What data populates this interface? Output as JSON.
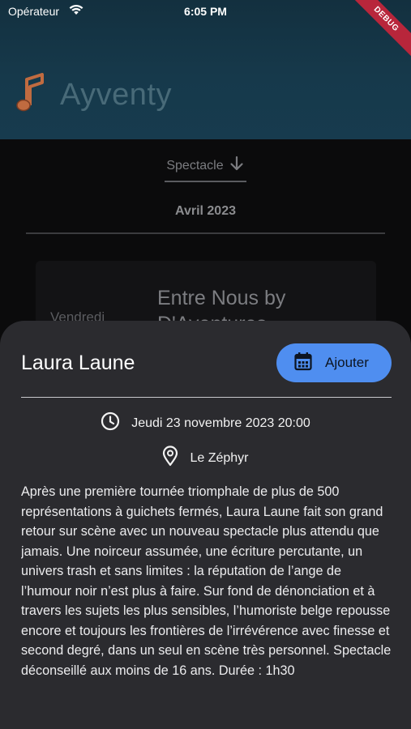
{
  "status_bar": {
    "carrier": "Opérateur",
    "time": "6:05 PM",
    "debug_label": "DEBUG"
  },
  "app": {
    "title": "Ayventy",
    "logo_icon": "music-note-icon"
  },
  "filter": {
    "label": "Spectacle",
    "icon": "arrow-down-icon"
  },
  "month": "Avril 2023",
  "event_card": {
    "day": "Vendredi",
    "title": "Entre Nous by D'Aventures"
  },
  "sheet": {
    "title": "Laura Laune",
    "add_button": "Ajouter",
    "date": "Jeudi 23 novembre 2023 20:00",
    "place": "Le Zéphyr",
    "description": "Après une première tournée triomphale de plus de 500 représentations à guichets fermés, Laura Laune fait son grand retour sur scène avec un nouveau spectacle plus attendu que jamais. Une noirceur assumée, une écriture percutante, un univers trash et sans limites : la réputation de l’ange de l’humour noir n’est plus à faire. Sur fond de dénonciation et à travers les sujets les plus sensibles, l’humoriste belge repousse encore et toujours les frontières de l’irrévérence avec finesse et second degré, dans un seul en scène très personnel. Spectacle déconseillé aux moins de 16 ans. Durée : 1h30"
  },
  "colors": {
    "accent": "#4f8ef0",
    "sheet_bg": "#2b2b2f",
    "header_bg": "#16394b",
    "debug": "#b8263b"
  }
}
